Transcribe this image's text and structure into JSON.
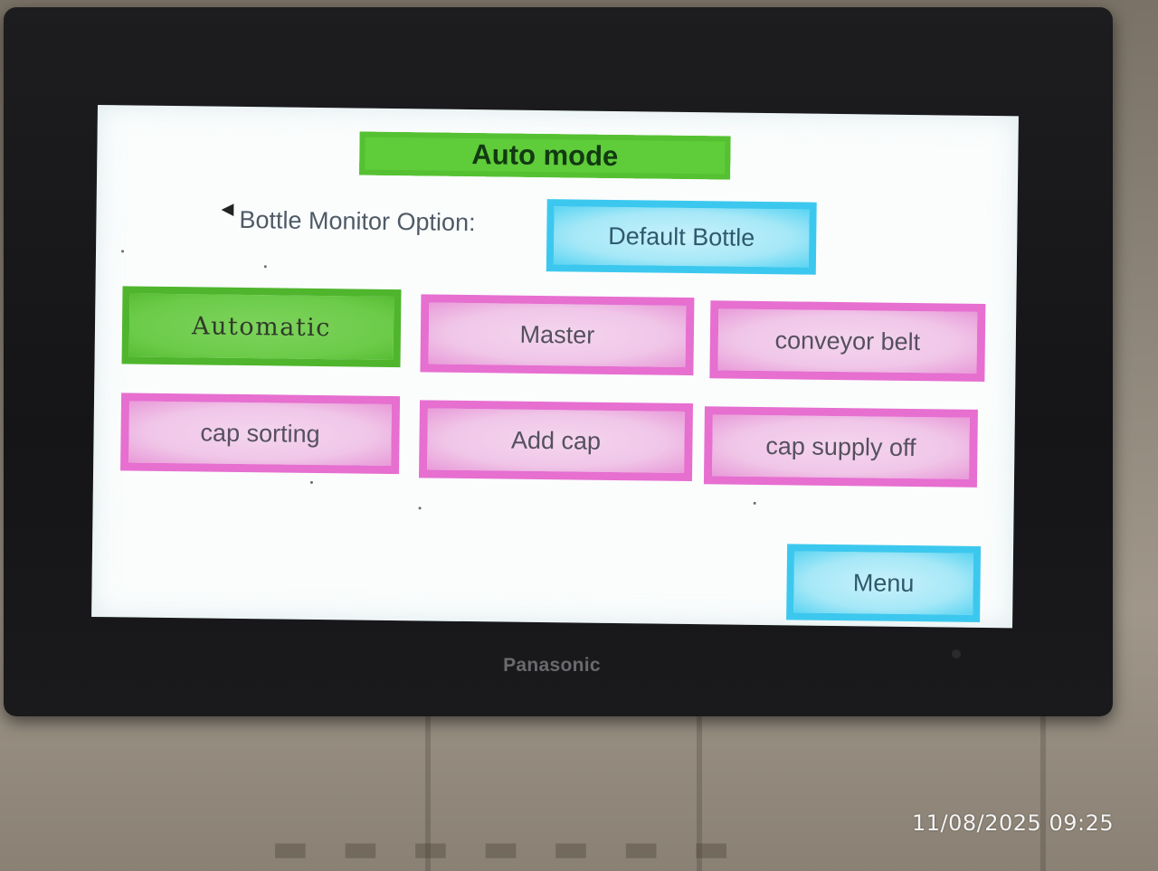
{
  "hmi": {
    "title": "Auto mode",
    "monitor_label": "Bottle Monitor Option:",
    "monitor_value": "Default Bottle",
    "buttons": [
      {
        "label": "Automatic",
        "state": "active",
        "color": "#5fcc3a"
      },
      {
        "label": "Master",
        "state": "inactive",
        "color": "#e66fd0"
      },
      {
        "label": "conveyor belt",
        "state": "inactive",
        "color": "#e66fd0"
      },
      {
        "label": "cap sorting",
        "state": "inactive",
        "color": "#e66fd0"
      },
      {
        "label": "Add cap",
        "state": "inactive",
        "color": "#e66fd0"
      },
      {
        "label": "cap supply off",
        "state": "inactive",
        "color": "#e66fd0"
      }
    ],
    "menu_label": "Menu"
  },
  "device": {
    "brand": "Panasonic"
  },
  "photo": {
    "timestamp": "11/08/2025 09:25"
  },
  "colors": {
    "title_green": "#5fcc3a",
    "active_green": "#5fcc3a",
    "inactive_pink": "#e66fd0",
    "nav_cyan": "#3cc8ee",
    "screen_bg": "#fbfdfd",
    "bezel": "#1a1a1c"
  }
}
